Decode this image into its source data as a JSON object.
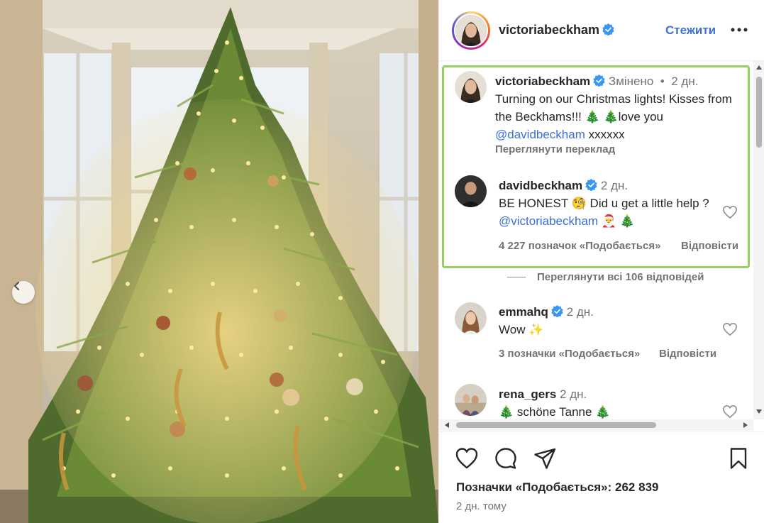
{
  "post": {
    "author": "victoriabeckham",
    "follow_label": "Стежити",
    "verified_color": "#3897f0",
    "accent_color": "#3b6fd6",
    "highlight_color": "#96d160"
  },
  "caption": {
    "username": "victoriabeckham",
    "edited": "Змінено",
    "time": "2 дн.",
    "text_before": "Turning on our Christmas lights! Kisses from the Beckhams!!! 🎄 🎄love you ",
    "mention": "@davidbeckham",
    "text_after": " xxxxxx",
    "translate_label": "Переглянути переклад"
  },
  "comments": [
    {
      "username": "davidbeckham",
      "verified": true,
      "time": "2 дн.",
      "text_before": "BE HONEST 🧐 Did u get a little help ? ",
      "mention": "@victoriabeckham",
      "text_after": " 🎅 🎄",
      "likes": "4 227 позначок «Подобається»",
      "reply_label": "Відповісти"
    },
    {
      "username": "emmahq",
      "verified": true,
      "time": "2 дн.",
      "text": "Wow ✨",
      "likes": "3 позначки «Подобається»",
      "reply_label": "Відповісти"
    },
    {
      "username": "rena_gers",
      "verified": false,
      "time": "2 дн.",
      "text": "🎄 schöne Tanne 🎄"
    }
  ],
  "view_replies_label": "Переглянути всі 106 відповідей",
  "footer": {
    "likes_text": "Позначки «Подобається»: 262 839",
    "time": "2 дн. тому"
  },
  "icons": {
    "prev": "chevron-left-icon",
    "more": "more-horizontal-icon",
    "like": "heart-icon",
    "comment": "comment-icon",
    "share": "share-icon",
    "save": "bookmark-icon"
  }
}
